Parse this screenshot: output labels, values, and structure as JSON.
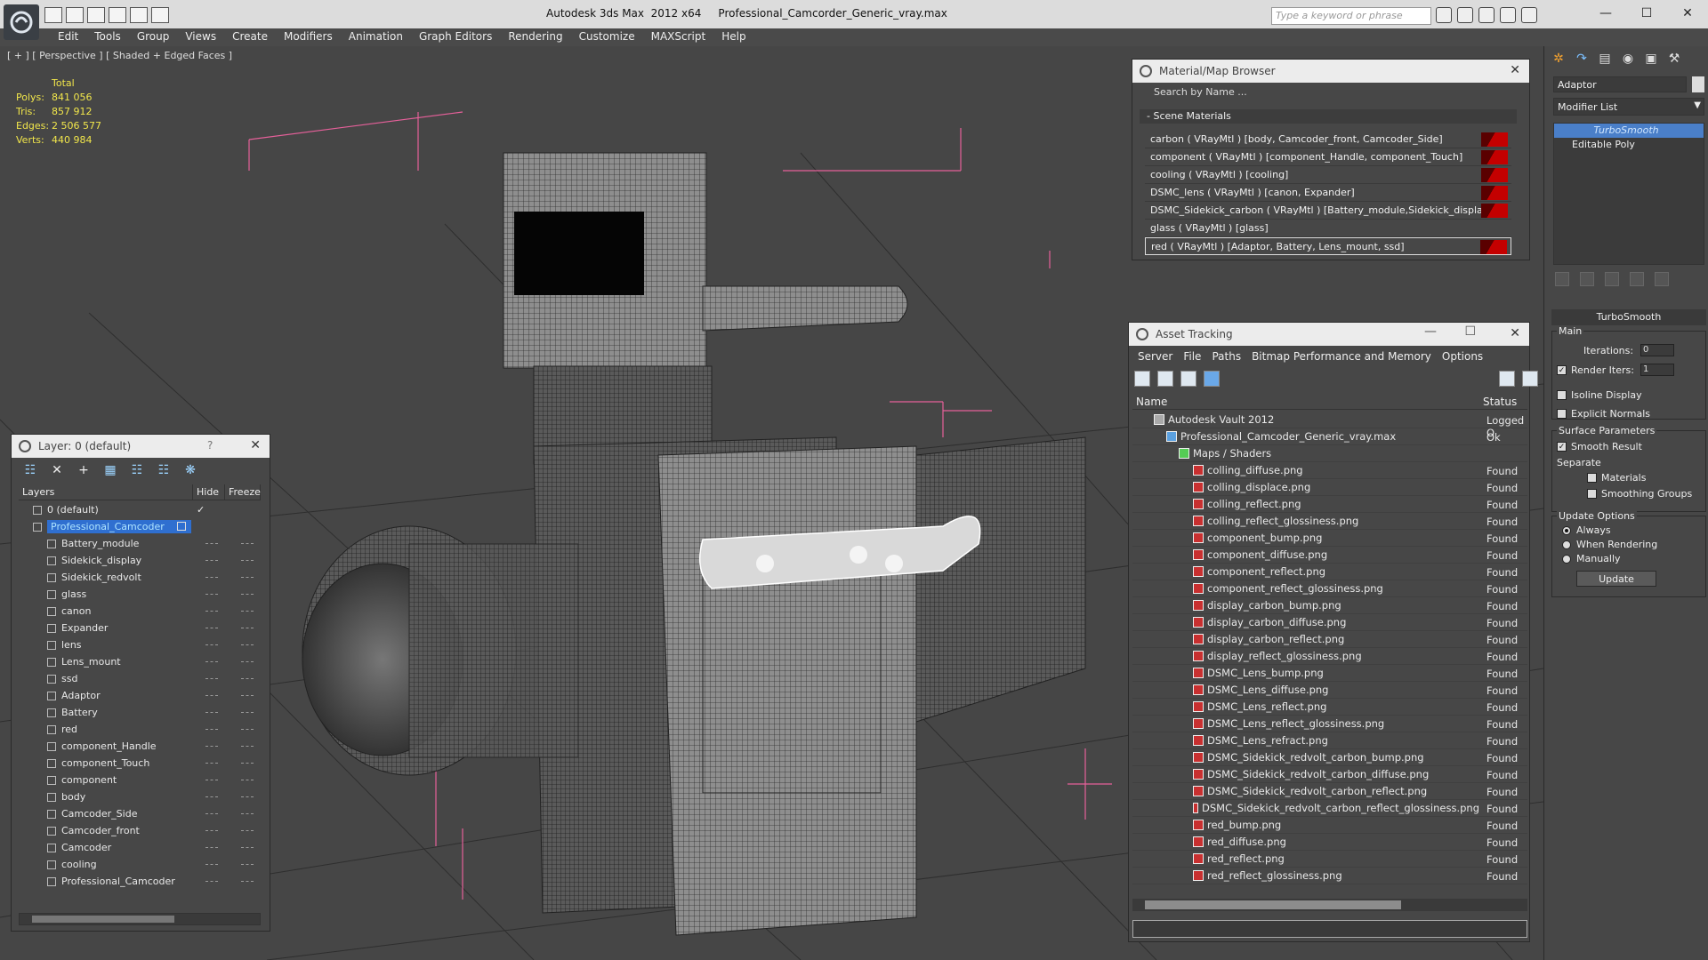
{
  "window": {
    "title": "Autodesk 3ds Max  2012 x64     Professional_Camcorder_Generic_vray.max",
    "search_placeholder": "Type a keyword or phrase"
  },
  "menu": [
    "Edit",
    "Tools",
    "Group",
    "Views",
    "Create",
    "Modifiers",
    "Animation",
    "Graph Editors",
    "Rendering",
    "Customize",
    "MAXScript",
    "Help"
  ],
  "viewport": {
    "label": "[ + ] [ Perspective ] [ Shaded + Edged Faces ]",
    "stats": {
      "header": "Total",
      "polys_label": "Polys:",
      "polys": "841 056",
      "tris_label": "Tris:",
      "tris": "857 912",
      "edges_label": "Edges:",
      "edges": "2 506 577",
      "verts_label": "Verts:",
      "verts": "440 984"
    }
  },
  "layer_panel": {
    "title": "Layer: 0 (default)",
    "help": "?",
    "col_layers": "Layers",
    "col_hide": "Hide",
    "col_freeze": "Freeze",
    "rows": [
      {
        "name": "0 (default)",
        "level": 1
      },
      {
        "name": "Professional_Camcoder",
        "level": 1
      },
      {
        "name": "Battery_module",
        "level": 2
      },
      {
        "name": "Sidekick_display",
        "level": 2
      },
      {
        "name": "Sidekick_redvolt",
        "level": 2
      },
      {
        "name": "glass",
        "level": 2
      },
      {
        "name": "canon",
        "level": 2
      },
      {
        "name": "Expander",
        "level": 2
      },
      {
        "name": "lens",
        "level": 2
      },
      {
        "name": "Lens_mount",
        "level": 2
      },
      {
        "name": "ssd",
        "level": 2
      },
      {
        "name": "Adaptor",
        "level": 2
      },
      {
        "name": "Battery",
        "level": 2
      },
      {
        "name": "red",
        "level": 2
      },
      {
        "name": "component_Handle",
        "level": 2
      },
      {
        "name": "component_Touch",
        "level": 2
      },
      {
        "name": "component",
        "level": 2
      },
      {
        "name": "body",
        "level": 2
      },
      {
        "name": "Camcoder_Side",
        "level": 2
      },
      {
        "name": "Camcoder_front",
        "level": 2
      },
      {
        "name": "Camcoder",
        "level": 2
      },
      {
        "name": "cooling",
        "level": 2
      },
      {
        "name": "Professional_Camcoder",
        "level": 2
      }
    ]
  },
  "material_browser": {
    "title": "Material/Map Browser",
    "search": "Search by Name ...",
    "section": "- Scene Materials",
    "materials": [
      "carbon  ( VRayMtl ) [body, Camcoder_front, Camcoder_Side]",
      "component  ( VRayMtl ) [component_Handle, component_Touch]",
      "cooling  ( VRayMtl ) [cooling]",
      "DSMC_lens  ( VRayMtl ) [canon, Expander]",
      "DSMC_Sidekick_carbon  ( VRayMtl ) [Battery_module,Sidekick_display]",
      "glass  ( VRayMtl ) [glass]",
      "red  ( VRayMtl ) [Adaptor, Battery, Lens_mount, ssd]"
    ]
  },
  "asset_tracking": {
    "title": "Asset Tracking",
    "menu": [
      "Server",
      "File",
      "Paths",
      "Bitmap Performance and Memory",
      "Options"
    ],
    "col_name": "Name",
    "col_status": "Status",
    "rows": [
      {
        "name": "Autodesk Vault 2012",
        "status": "Logged O",
        "kind": "vault"
      },
      {
        "name": "Professional_Camcoder_Generic_vray.max",
        "status": "Ok",
        "kind": "max"
      },
      {
        "name": "Maps / Shaders",
        "status": "",
        "kind": "group"
      },
      {
        "name": "colling_diffuse.png",
        "status": "Found",
        "kind": "png"
      },
      {
        "name": "colling_displace.png",
        "status": "Found",
        "kind": "png"
      },
      {
        "name": "colling_reflect.png",
        "status": "Found",
        "kind": "png"
      },
      {
        "name": "colling_reflect_glossiness.png",
        "status": "Found",
        "kind": "png"
      },
      {
        "name": "component_bump.png",
        "status": "Found",
        "kind": "png"
      },
      {
        "name": "component_diffuse.png",
        "status": "Found",
        "kind": "png"
      },
      {
        "name": "component_reflect.png",
        "status": "Found",
        "kind": "png"
      },
      {
        "name": "component_reflect_glossiness.png",
        "status": "Found",
        "kind": "png"
      },
      {
        "name": "display_carbon_bump.png",
        "status": "Found",
        "kind": "png"
      },
      {
        "name": "display_carbon_diffuse.png",
        "status": "Found",
        "kind": "png"
      },
      {
        "name": "display_carbon_reflect.png",
        "status": "Found",
        "kind": "png"
      },
      {
        "name": "display_reflect_glossiness.png",
        "status": "Found",
        "kind": "png"
      },
      {
        "name": "DSMC_Lens_bump.png",
        "status": "Found",
        "kind": "png"
      },
      {
        "name": "DSMC_Lens_diffuse.png",
        "status": "Found",
        "kind": "png"
      },
      {
        "name": "DSMC_Lens_reflect.png",
        "status": "Found",
        "kind": "png"
      },
      {
        "name": "DSMC_Lens_reflect_glossiness.png",
        "status": "Found",
        "kind": "png"
      },
      {
        "name": "DSMC_Lens_refract.png",
        "status": "Found",
        "kind": "png"
      },
      {
        "name": "DSMC_Sidekick_redvolt_carbon_bump.png",
        "status": "Found",
        "kind": "png"
      },
      {
        "name": "DSMC_Sidekick_redvolt_carbon_diffuse.png",
        "status": "Found",
        "kind": "png"
      },
      {
        "name": "DSMC_Sidekick_redvolt_carbon_reflect.png",
        "status": "Found",
        "kind": "png"
      },
      {
        "name": "DSMC_Sidekick_redvolt_carbon_reflect_glossiness.png",
        "status": "Found",
        "kind": "png"
      },
      {
        "name": "red_bump.png",
        "status": "Found",
        "kind": "png"
      },
      {
        "name": "red_diffuse.png",
        "status": "Found",
        "kind": "png"
      },
      {
        "name": "red_reflect.png",
        "status": "Found",
        "kind": "png"
      },
      {
        "name": "red_reflect_glossiness.png",
        "status": "Found",
        "kind": "png"
      }
    ]
  },
  "command_panel": {
    "object_name": "Adaptor",
    "modifier_list": "Modifier List",
    "stack": [
      "TurboSmooth",
      "Editable Poly"
    ],
    "rollout_title": "TurboSmooth",
    "main_label": "Main",
    "iterations_label": "Iterations:",
    "iterations": "0",
    "render_iters_label": "Render Iters:",
    "render_iters": "1",
    "isoline": "Isoline Display",
    "explicit_normals": "Explicit Normals",
    "surface_params": "Surface Parameters",
    "smooth_result": "Smooth Result",
    "separate": "Separate",
    "materials": "Materials",
    "smoothing_groups": "Smoothing Groups",
    "update_options": "Update Options",
    "always": "Always",
    "when_rendering": "When Rendering",
    "manually": "Manually",
    "update": "Update"
  },
  "colors": {
    "selection_blue": "#2f6fd0",
    "stats_yellow": "#f1e64b",
    "helper_pink": "#e6609a",
    "material_red": "#c40000"
  }
}
